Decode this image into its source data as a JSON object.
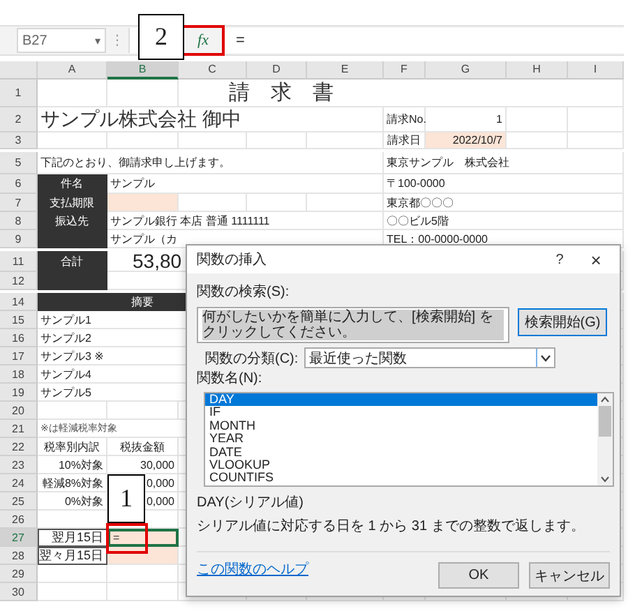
{
  "formula_bar": {
    "name_box": "B27",
    "name_caret": "▾",
    "separator": "⋮",
    "fx_button": {
      "label": "fx",
      "highlighted": true
    },
    "formula": "="
  },
  "columns": [
    {
      "label": "A",
      "selected": false
    },
    {
      "label": "B",
      "selected": true
    },
    {
      "label": "C",
      "selected": false
    },
    {
      "label": "D",
      "selected": false
    },
    {
      "label": "E",
      "selected": false
    },
    {
      "label": "F",
      "selected": false
    },
    {
      "label": "G",
      "selected": false
    },
    {
      "label": "H",
      "selected": false
    },
    {
      "label": "I",
      "selected": false
    }
  ],
  "rows": [
    {
      "number": "1",
      "selected": false,
      "cells": {
        "C": {
          "text": "請　求　書",
          "kind": "title"
        }
      }
    },
    {
      "number": "2",
      "selected": false,
      "cells": {
        "A": {
          "text": "サンプル株式会社 御中",
          "kind": "heading"
        },
        "F": {
          "text": "請求No.",
          "kind": "text"
        },
        "G": {
          "text": "1",
          "kind": "number"
        }
      }
    },
    {
      "number": "3",
      "selected": false,
      "cells": {
        "F": {
          "text": "請求日",
          "kind": "center"
        },
        "G": {
          "text": "2022/10/7",
          "kind": "fill-number"
        }
      }
    },
    {
      "number": "5",
      "selected": false,
      "cells": {
        "A": {
          "text": "下記のとおり、御請求申し上げます。",
          "kind": "text"
        },
        "F": {
          "text": "東京サンプル　株式会社",
          "kind": "text"
        }
      }
    },
    {
      "number": "6",
      "selected": false,
      "cells": {
        "A": {
          "text": "件名",
          "kind": "label"
        },
        "B": {
          "text": "サンプル",
          "kind": "text"
        },
        "F": {
          "text": "〒100-0000",
          "kind": "text"
        }
      }
    },
    {
      "number": "7",
      "selected": false,
      "cells": {
        "A": {
          "text": "支払期限",
          "kind": "label"
        },
        "B": {
          "kind": "fill"
        },
        "F": {
          "text": "東京都〇〇〇",
          "kind": "text"
        }
      }
    },
    {
      "number": "8",
      "selected": false,
      "cells": {
        "A": {
          "text": "振込先",
          "kind": "label"
        },
        "B": {
          "text": "サンプル銀行 本店 普通 1111111",
          "kind": "text"
        },
        "F": {
          "text": "〇〇ビル5階",
          "kind": "text"
        }
      }
    },
    {
      "number": "9",
      "selected": false,
      "cells": {
        "A": {
          "kind": "label"
        },
        "B": {
          "text": "サンプル（カ",
          "kind": "text"
        },
        "F": {
          "text": "TEL：00-0000-0000",
          "kind": "text"
        }
      }
    },
    {
      "number": "11",
      "selected": false,
      "cells": {
        "A": {
          "text": "合計",
          "kind": "label"
        },
        "B": {
          "text": "53,80",
          "kind": "total"
        }
      }
    },
    {
      "number": "12",
      "selected": false,
      "cells": {
        "A": {
          "kind": "label"
        },
        "B": {
          "kind": "total"
        }
      }
    },
    {
      "number": "14",
      "selected": false,
      "cells": {
        "A": {
          "kind": "band"
        },
        "B": {
          "text": "摘要",
          "kind": "band"
        },
        "C": {
          "kind": "band"
        }
      }
    },
    {
      "number": "15",
      "selected": false,
      "cells": {
        "A": {
          "text": "サンプル1",
          "kind": "text"
        }
      }
    },
    {
      "number": "16",
      "selected": false,
      "cells": {
        "A": {
          "text": "サンプル2",
          "kind": "text"
        }
      }
    },
    {
      "number": "17",
      "selected": false,
      "cells": {
        "A": {
          "text": "サンプル3 ※",
          "kind": "text"
        }
      }
    },
    {
      "number": "18",
      "selected": false,
      "cells": {
        "A": {
          "text": "サンプル4",
          "kind": "text"
        }
      }
    },
    {
      "number": "19",
      "selected": false,
      "cells": {
        "A": {
          "text": "サンプル5",
          "kind": "text"
        }
      }
    },
    {
      "number": "20",
      "selected": false,
      "cells": {}
    },
    {
      "number": "21",
      "selected": false,
      "cells": {
        "A": {
          "text": "※は軽減税率対象",
          "kind": "note"
        }
      }
    },
    {
      "number": "22",
      "selected": false,
      "cells": {
        "A": {
          "text": "税率別内訳",
          "kind": "center"
        },
        "B": {
          "text": "税抜金額",
          "kind": "center"
        }
      }
    },
    {
      "number": "23",
      "selected": false,
      "cells": {
        "A": {
          "text": "10%対象",
          "kind": "number"
        },
        "B": {
          "text": "30,000",
          "kind": "number"
        }
      }
    },
    {
      "number": "24",
      "selected": false,
      "cells": {
        "A": {
          "text": "軽減8%対象",
          "kind": "number"
        },
        "B": {
          "text": "0,000",
          "kind": "number"
        }
      }
    },
    {
      "number": "25",
      "selected": false,
      "cells": {
        "A": {
          "text": "0%対象",
          "kind": "number"
        },
        "B": {
          "text": "0,000",
          "kind": "number"
        }
      }
    },
    {
      "number": "26",
      "selected": false,
      "cells": {}
    },
    {
      "number": "27",
      "selected": true,
      "cells": {
        "A": {
          "text": "翌月15日",
          "kind": "boxed"
        },
        "B": {
          "text": "=",
          "kind": "fill",
          "active": true,
          "highlighted": true
        }
      }
    },
    {
      "number": "28",
      "selected": false,
      "cells": {
        "A": {
          "text": "翌々月15日",
          "kind": "boxed"
        },
        "B": {
          "kind": "fill"
        }
      }
    },
    {
      "number": "29",
      "selected": false,
      "cells": {}
    },
    {
      "number": "30",
      "selected": false,
      "cells": {}
    }
  ],
  "dialog": {
    "title": "関数の挿入",
    "help": "?",
    "close": "×",
    "search_label": "関数の検索(S):",
    "search_value": "何がしたいかを簡単に入力して、[検索開始] をクリックしてください。",
    "search_button": "検索開始(G)",
    "category_label": "関数の分類(C):",
    "category_value": "最近使った関数",
    "list_label": "関数名(N):",
    "functions": [
      {
        "name": "DAY",
        "selected": true
      },
      {
        "name": "IF",
        "selected": false
      },
      {
        "name": "MONTH",
        "selected": false
      },
      {
        "name": "YEAR",
        "selected": false
      },
      {
        "name": "DATE",
        "selected": false
      },
      {
        "name": "VLOOKUP",
        "selected": false
      },
      {
        "name": "COUNTIFS",
        "selected": false
      }
    ],
    "signature": "DAY(シリアル値)",
    "description": "シリアル値に対応する日を 1 から 31 までの整数で返します。",
    "help_link": "この関数のヘルプ",
    "buttons": [
      "OK",
      "キャンセル"
    ]
  },
  "callouts": [
    {
      "number": "1"
    },
    {
      "number": "2"
    }
  ]
}
